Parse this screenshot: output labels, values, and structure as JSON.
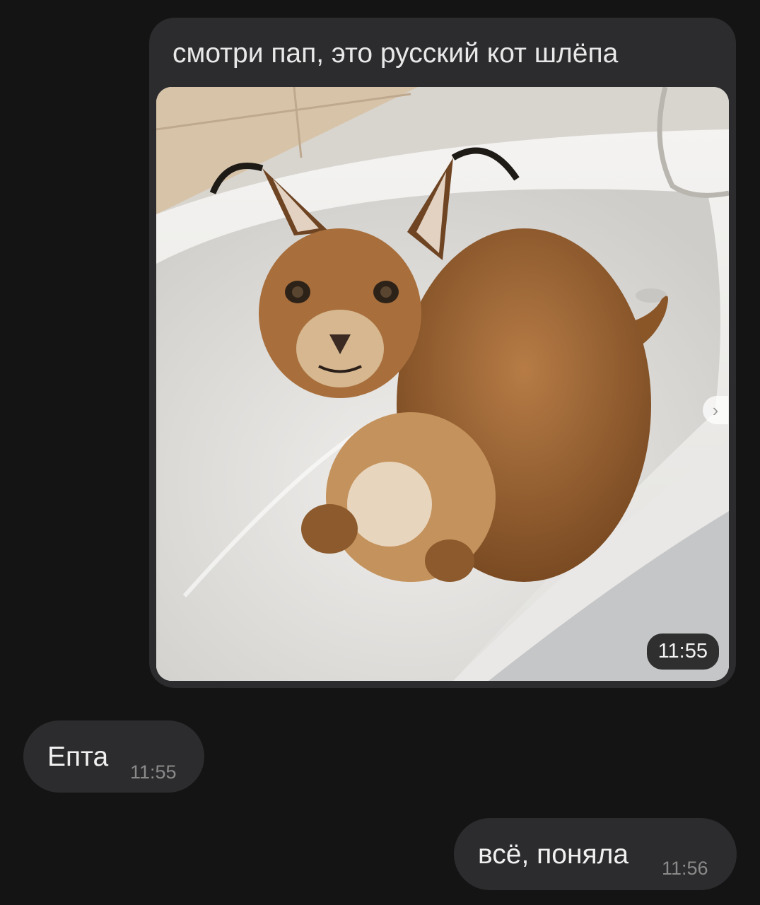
{
  "messages": [
    {
      "kind": "photo",
      "direction": "outgoing",
      "caption": "смотри пап, это русский кот шлёпа",
      "time": "11:55",
      "image_subject": "caracal-in-bathtub"
    },
    {
      "kind": "text",
      "direction": "incoming",
      "text": "Епта",
      "time": "11:55"
    },
    {
      "kind": "text",
      "direction": "outgoing",
      "text": "всё, поняла",
      "time": "11:56"
    }
  ],
  "icons": {
    "photo_next": "chevron-right-icon",
    "next_glyph": "›"
  },
  "colors": {
    "background": "#141414",
    "bubble": "#2c2c2e",
    "text": "#f0f0f0",
    "time": "#8a8a8a"
  }
}
